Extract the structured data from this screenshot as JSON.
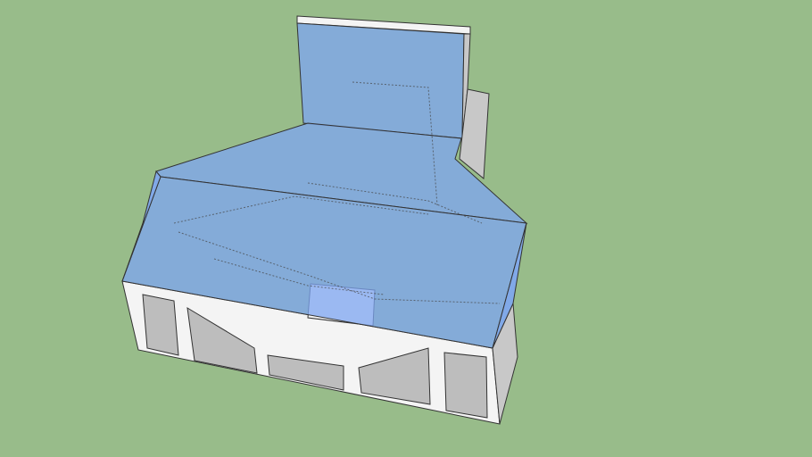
{
  "viewport": {
    "background_color": "#98bc8a",
    "glass_color": "#7ea6f2",
    "wall_color": "#f4f4f4",
    "shadow_color": "#c8c8c8",
    "edge_color": "#333333"
  }
}
